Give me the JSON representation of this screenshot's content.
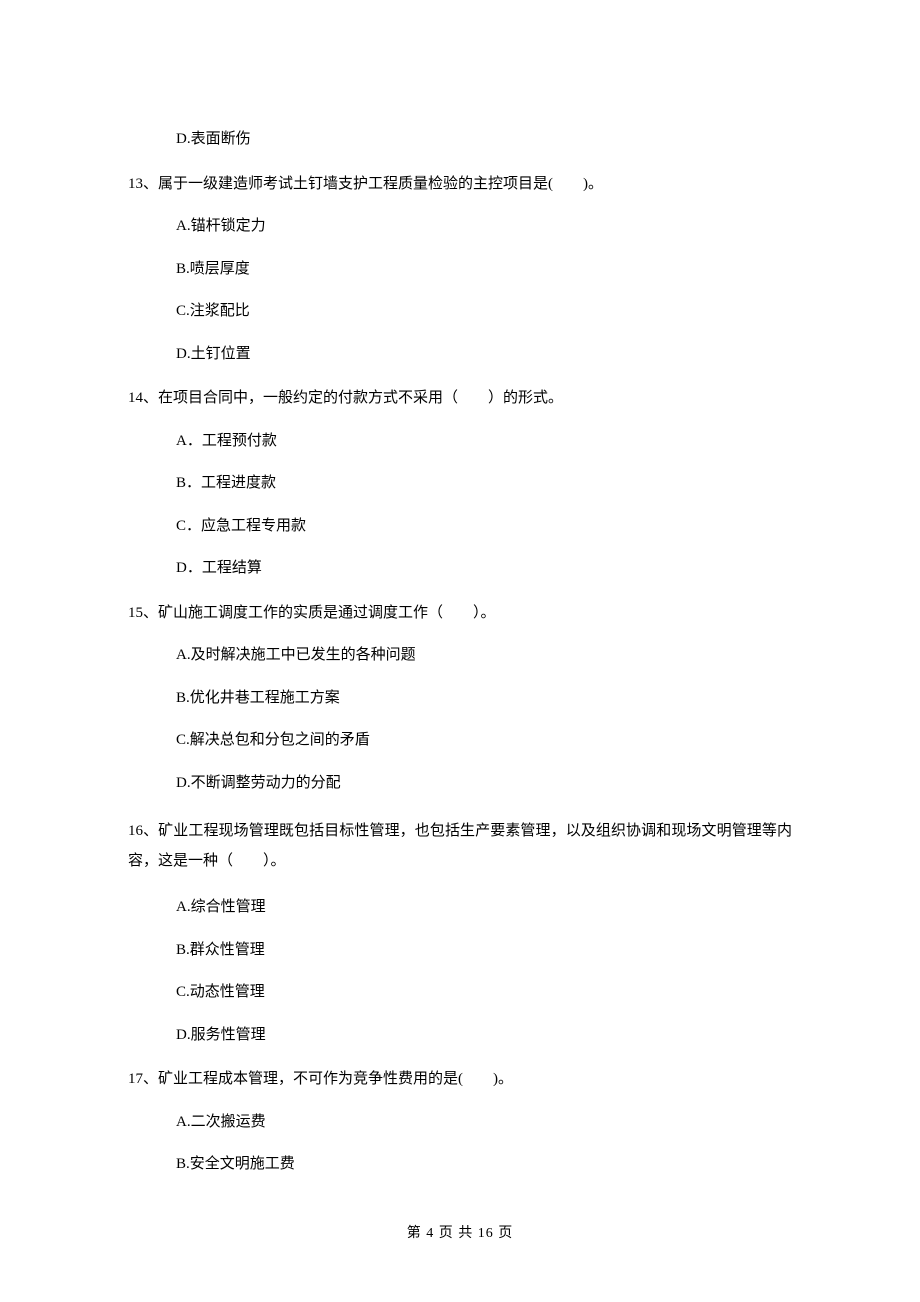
{
  "q12": {
    "D": "D.表面断伤"
  },
  "q13": {
    "stem": "13、属于一级建造师考试土钉墙支护工程质量检验的主控项目是(　　)。",
    "A": "A.锚杆锁定力",
    "B": "B.喷层厚度",
    "C": "C.注浆配比",
    "D": "D.土钉位置"
  },
  "q14": {
    "stem": "14、在项目合同中，一般约定的付款方式不采用（　　）的形式。",
    "A": "A．工程预付款",
    "B": "B．工程进度款",
    "C": "C．应急工程专用款",
    "D": "D．工程结算"
  },
  "q15": {
    "stem": "15、矿山施工调度工作的实质是通过调度工作（　　）。",
    "A": "A.及时解决施工中已发生的各种问题",
    "B": "B.优化井巷工程施工方案",
    "C": "C.解决总包和分包之间的矛盾",
    "D": "D.不断调整劳动力的分配"
  },
  "q16": {
    "stem": "16、矿业工程现场管理既包括目标性管理，也包括生产要素管理，以及组织协调和现场文明管理等内容，这是一种（　　）。",
    "A": "A.综合性管理",
    "B": "B.群众性管理",
    "C": "C.动态性管理",
    "D": "D.服务性管理"
  },
  "q17": {
    "stem": "17、矿业工程成本管理，不可作为竞争性费用的是(　　)。",
    "A": "A.二次搬运费",
    "B": "B.安全文明施工费"
  },
  "footer": "第 4 页 共 16 页"
}
